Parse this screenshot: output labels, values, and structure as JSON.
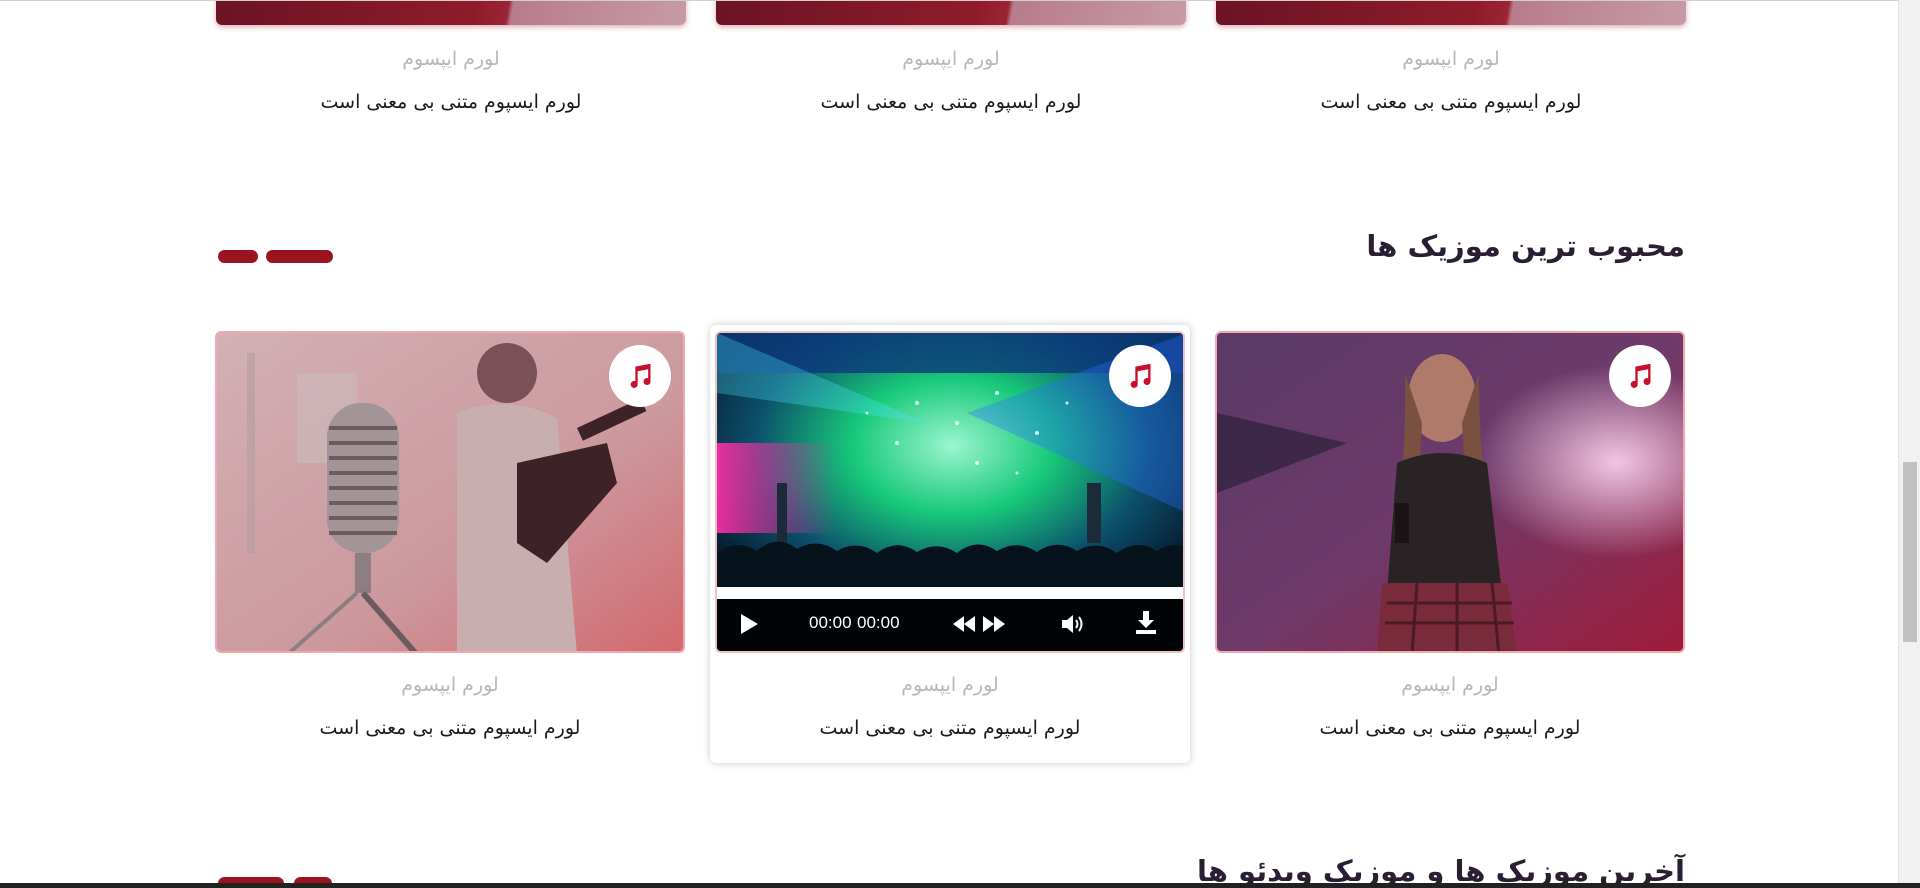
{
  "top_cards": [
    {
      "subtitle": "لورم ایپسوم",
      "title": "لورم ایسپوم متنی بی معنی است"
    },
    {
      "subtitle": "لورم ایپسوم",
      "title": "لورم ایسپوم متنی بی معنی است"
    },
    {
      "subtitle": "لورم ایپسوم",
      "title": "لورم ایسپوم متنی بی معنی است"
    }
  ],
  "popular_section": {
    "title": "محبوب ترین موزیک ها",
    "cards": [
      {
        "subtitle": "لورم ایپسوم",
        "title": "لورم ایسپوم متنی بی معنی است",
        "icon": "music-note-icon"
      },
      {
        "subtitle": "لورم ایپسوم",
        "title": "لورم ایسپوم متنی بی معنی است",
        "icon": "music-note-icon"
      },
      {
        "subtitle": "لورم ایپسوم",
        "title": "لورم ایسپوم متنی بی معنی است",
        "icon": "music-note-icon"
      }
    ],
    "player": {
      "current_time": "00:00",
      "duration": "00:00"
    }
  },
  "latest_section": {
    "title": "آخرین موزیک ها و موزیک ویدئو ها"
  },
  "colors": {
    "accent": "#9a1420",
    "note": "#c8102e",
    "heading": "#2a1e33",
    "muted": "#b7b7b7"
  }
}
